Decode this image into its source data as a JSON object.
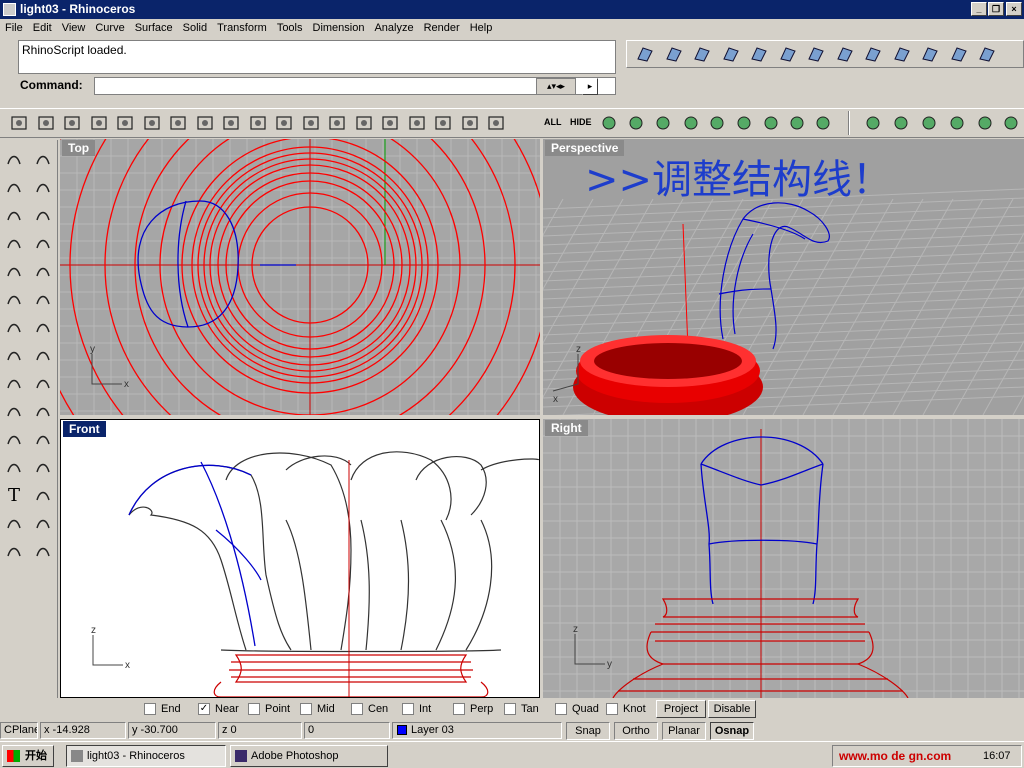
{
  "window": {
    "title": "light03 - Rhinoceros"
  },
  "menu": [
    "File",
    "Edit",
    "View",
    "Curve",
    "Surface",
    "Solid",
    "Transform",
    "Tools",
    "Dimension",
    "Analyze",
    "Render",
    "Help"
  ],
  "command": {
    "history": "RhinoScript loaded.",
    "label": "Command:",
    "value": ""
  },
  "toolbar": {
    "all_label": "ALL",
    "hide_label": "HIDE"
  },
  "viewports": {
    "top": {
      "title": "Top"
    },
    "perspective": {
      "title": "Perspective",
      "annotation": ">>调整结构线！"
    },
    "front": {
      "title": "Front"
    },
    "right": {
      "title": "Right"
    }
  },
  "axis": {
    "x": "x",
    "y": "y",
    "z": "z"
  },
  "osnap": {
    "items": [
      {
        "label": "End",
        "checked": false
      },
      {
        "label": "Near",
        "checked": true
      },
      {
        "label": "Point",
        "checked": false
      },
      {
        "label": "Mid",
        "checked": false
      },
      {
        "label": "Cen",
        "checked": false
      },
      {
        "label": "Int",
        "checked": false
      },
      {
        "label": "Perp",
        "checked": false
      },
      {
        "label": "Tan",
        "checked": false
      },
      {
        "label": "Quad",
        "checked": false
      },
      {
        "label": "Knot",
        "checked": false
      }
    ],
    "project": "Project",
    "disable": "Disable",
    "check_mark": "✓"
  },
  "status": {
    "cplane": "CPlane",
    "x": "x -14.928",
    "y": "y -30.700",
    "z": "z 0",
    "w": "0",
    "layer": "Layer 03",
    "layer_color": "#0000ff",
    "snap": "Snap",
    "ortho": "Ortho",
    "planar": "Planar",
    "osnap": "Osnap"
  },
  "taskbar": {
    "start": "开始",
    "tasks": [
      "light03 - Rhinoceros",
      "Adobe Photoshop"
    ],
    "tray_text": "www.mo  de    gn.com",
    "clock": "16:07"
  },
  "colors": {
    "curve_red": "#ff0000",
    "curve_blue": "#0000cc",
    "title_blue": "#0a246a",
    "viewport_gray": "#a0a0a0"
  }
}
